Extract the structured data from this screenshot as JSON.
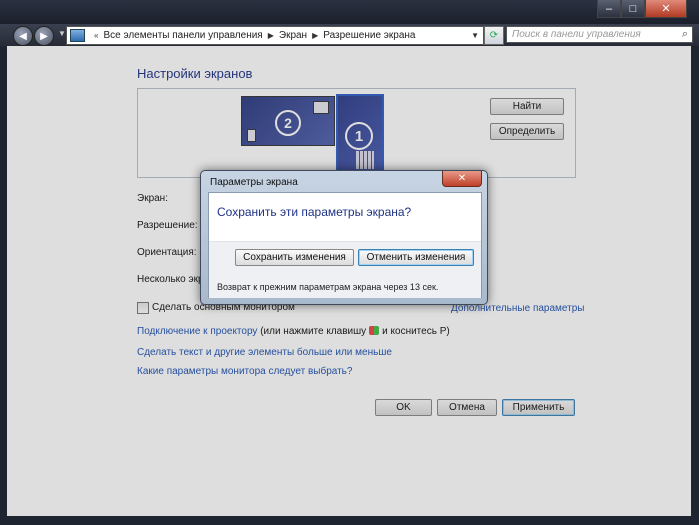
{
  "window": {
    "caption_buttons": [
      "minimize-icon",
      "maximize-icon",
      "close-icon"
    ]
  },
  "addressbar": {
    "breadcrumbs": [
      "Все элементы панели управления",
      "Экран",
      "Разрешение экрана"
    ],
    "search_placeholder": "Поиск в панели управления"
  },
  "main": {
    "heading": "Настройки экранов",
    "identify_buttons": {
      "find": "Найти",
      "detect": "Определить"
    },
    "monitors": [
      {
        "number": "1",
        "selected": true
      },
      {
        "number": "2",
        "selected": false
      }
    ],
    "fields": {
      "screen": "Экран:",
      "resolution": "Разрешение:",
      "orientation": "Ориентация:",
      "multiple": "Несколько экра"
    },
    "make_main_checkbox": "Сделать основным монитором",
    "advanced_link": "Дополнительные параметры",
    "projector_link": "Подключение к проектору",
    "projector_hint_before": "(или нажмите клавишу",
    "projector_hint_after": "и коснитесь P)",
    "bigger_text_link": "Сделать текст и другие элементы больше или меньше",
    "which_settings_link": "Какие параметры монитора следует выбрать?",
    "footer_buttons": {
      "ok": "OK",
      "cancel": "Отмена",
      "apply": "Применить"
    }
  },
  "dialog": {
    "title": "Параметры экрана",
    "question": "Сохранить эти параметры экрана?",
    "save_button": "Сохранить изменения",
    "revert_button": "Отменить изменения",
    "countdown": "Возврат к прежним параметрам экрана через 13 сек."
  }
}
